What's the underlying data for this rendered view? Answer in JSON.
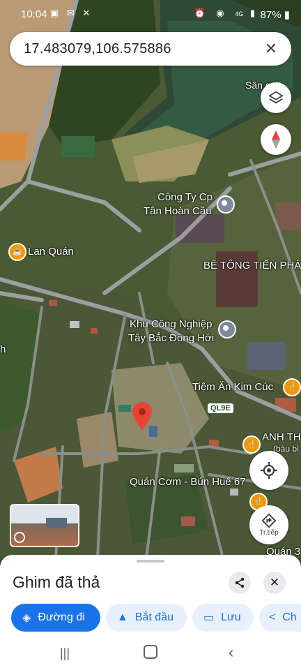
{
  "status_bar": {
    "time": "10:04",
    "signal_label": "4G",
    "battery": "87%"
  },
  "search": {
    "query": "17.483079,106.575886"
  },
  "map": {
    "labels": {
      "san_partial": "Sân golf",
      "cong_ty_line1": "Công Ty Cp",
      "cong_ty_line2": "Tân Hoàn Cầu",
      "lan_quan": "Lan Quán",
      "be_tong": "BÊ TÔNG TIẾN PHÁ",
      "kcn_line1": "Khu Công Nghiệp",
      "kcn_line2": "Tây Bắc Đồng Hới",
      "tiem_an": "Tiệm Ăn Kim Cúc",
      "ql9e": "QL9E",
      "anh_th": "ANH TH",
      "anh_th_sub": "(bàu bì",
      "quan_com": "Quán Cơm - Bún Huế 67",
      "quan3": "Quán 3",
      "h_partial": "h"
    },
    "streetview_label": "Street View",
    "directions_fab": "Tr.tiếp"
  },
  "sheet": {
    "title": "Ghim đã thả",
    "actions": [
      {
        "label": "Đường đi",
        "icon": "directions-icon"
      },
      {
        "label": "Bắt đầu",
        "icon": "navigation-arrow-icon"
      },
      {
        "label": "Lưu",
        "icon": "bookmark-icon"
      },
      {
        "label": "Ch",
        "icon": "share-icon"
      }
    ]
  },
  "colors": {
    "primary": "#1a73e8",
    "pin": "#ea4335",
    "restaurant_pin": "#f29900"
  }
}
